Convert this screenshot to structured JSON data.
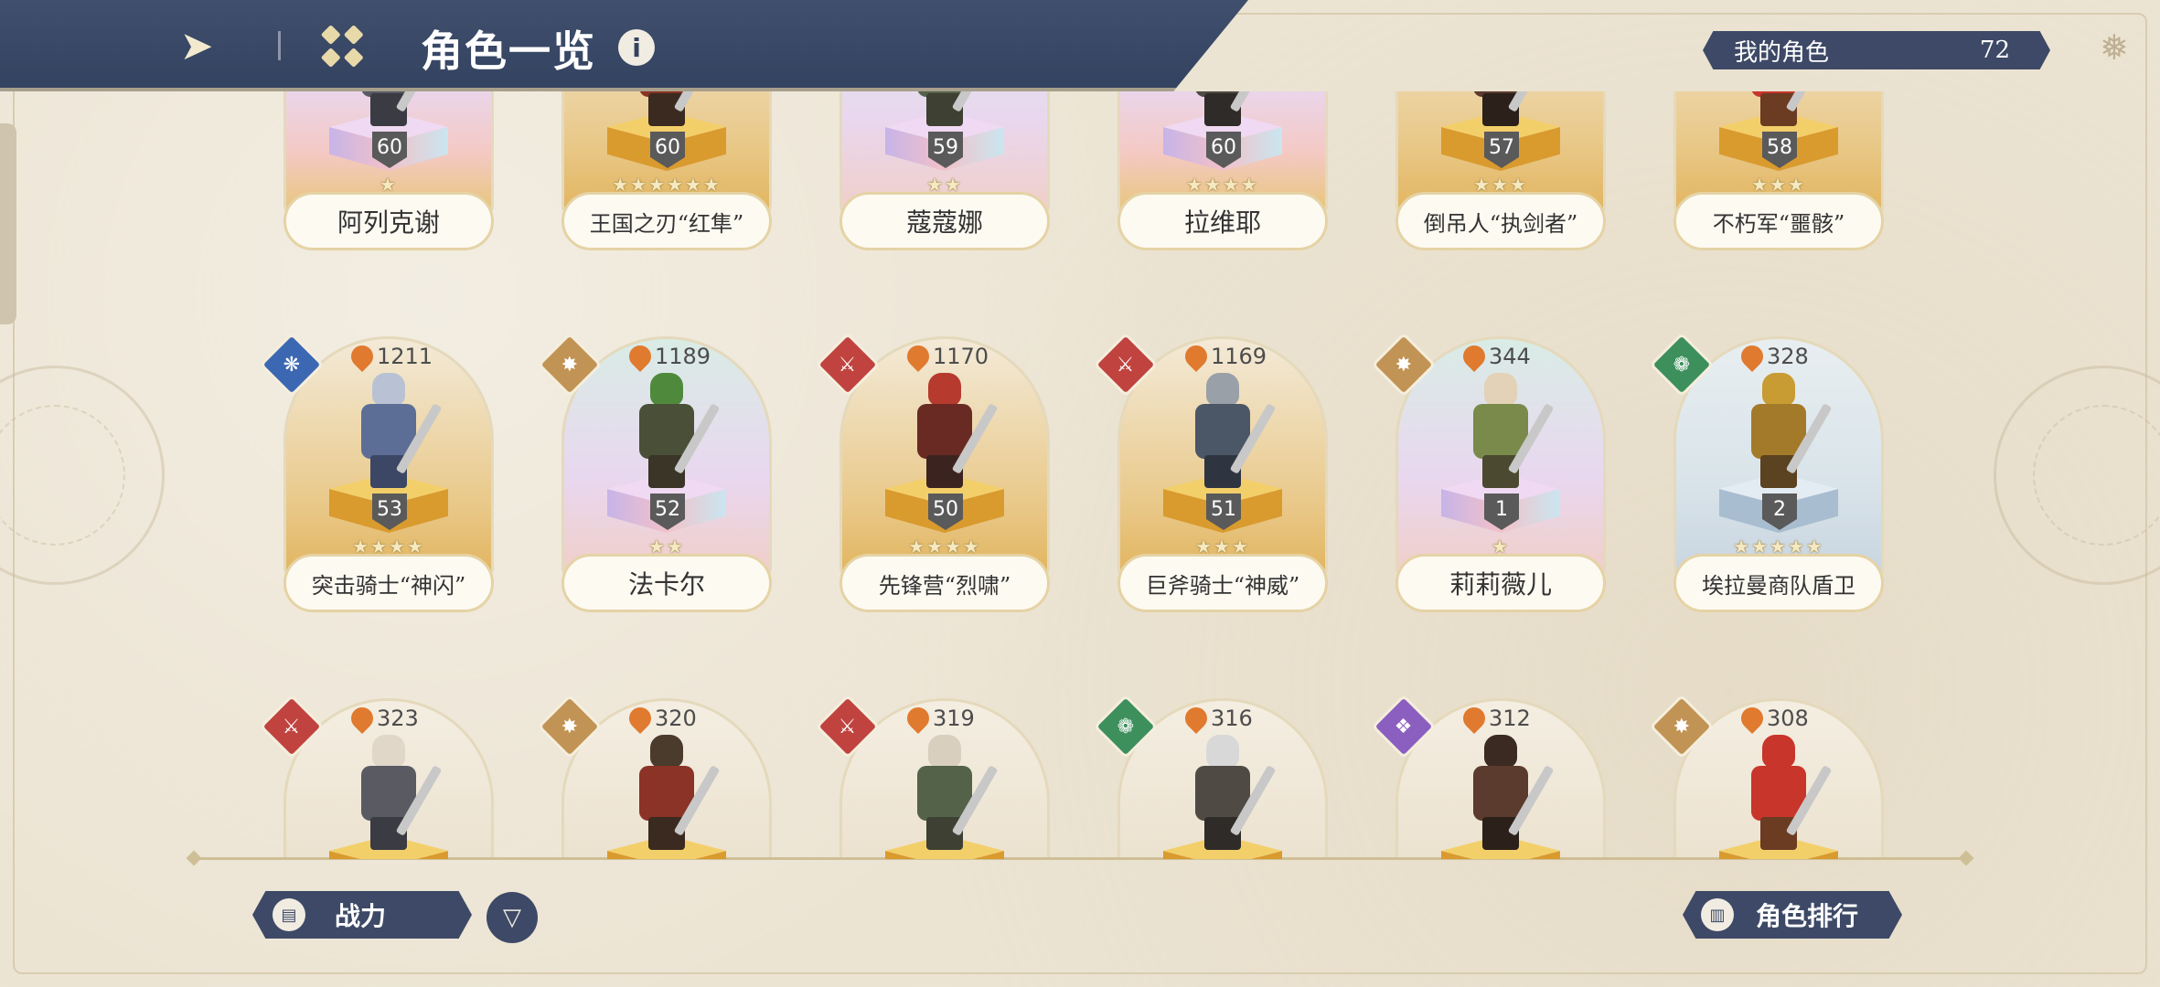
{
  "header": {
    "title": "角色一览",
    "back_icon": "back-arrow-icon",
    "menu_icon": "grid-menu-icon",
    "info_icon": "info-icon",
    "info_label": "i",
    "my_chars_label": "我的角色",
    "my_chars_count": "72"
  },
  "footer": {
    "sort_label": "战力",
    "sort_icon": "bar-chart-icon",
    "filter_icon": "filter-icon",
    "rank_label": "角色排行",
    "rank_icon": "podium-icon"
  },
  "colors": {
    "header": "#3f4f6d",
    "button": "#3d4966",
    "fire": "#c0433f",
    "wind": "#3d8f5c",
    "water": "#3c68b3",
    "light": "#c19354",
    "dark": "#8b5fbf"
  },
  "characters": [
    {
      "name": "阿列克谢",
      "level": "60",
      "stars": "★",
      "element": "wind",
      "pedestal": "rainbow",
      "card": "rainbow",
      "power": ""
    },
    {
      "name": "王国之刃“红隼”",
      "level": "60",
      "stars": "★★★★★★",
      "element": "water",
      "pedestal": "gold",
      "card": "gold",
      "power": ""
    },
    {
      "name": "蔻蔻娜",
      "level": "59",
      "stars": "★★",
      "element": "wind",
      "pedestal": "rainbow",
      "card": "teal",
      "power": ""
    },
    {
      "name": "拉维耶",
      "level": "60",
      "stars": "★★★★",
      "element": "fire",
      "pedestal": "rainbow",
      "card": "rainbow",
      "power": ""
    },
    {
      "name": "倒吊人“执剑者”",
      "level": "57",
      "stars": "★★★",
      "element": "dark",
      "pedestal": "gold",
      "card": "gold",
      "power": ""
    },
    {
      "name": "不朽军“噩骸”",
      "level": "58",
      "stars": "★★★",
      "element": "fire",
      "pedestal": "gold",
      "card": "gold",
      "power": ""
    },
    {
      "name": "突击骑士“神闪”",
      "level": "53",
      "stars": "★★★★",
      "element": "water",
      "pedestal": "gold",
      "card": "gold",
      "power": "1211"
    },
    {
      "name": "法卡尔",
      "level": "52",
      "stars": "★★",
      "element": "light",
      "pedestal": "rainbow",
      "card": "teal",
      "power": "1189"
    },
    {
      "name": "先锋营“烈啸”",
      "level": "50",
      "stars": "★★★★",
      "element": "fire",
      "pedestal": "gold",
      "card": "gold",
      "power": "1170"
    },
    {
      "name": "巨斧骑士“神威”",
      "level": "51",
      "stars": "★★★",
      "element": "fire",
      "pedestal": "gold",
      "card": "gold",
      "power": "1169"
    },
    {
      "name": "莉莉薇儿",
      "level": "1",
      "stars": "★",
      "element": "light",
      "pedestal": "rainbow",
      "card": "teal",
      "power": "344"
    },
    {
      "name": "埃拉曼商队盾卫",
      "level": "2",
      "stars": "★★★★★",
      "element": "wind",
      "pedestal": "silver",
      "card": "silver",
      "power": "328"
    },
    {
      "name": "",
      "level": "",
      "stars": "",
      "element": "fire",
      "pedestal": "gold",
      "card": "plain",
      "power": "323"
    },
    {
      "name": "",
      "level": "",
      "stars": "",
      "element": "light",
      "pedestal": "gold",
      "card": "plain",
      "power": "320"
    },
    {
      "name": "",
      "level": "",
      "stars": "",
      "element": "fire",
      "pedestal": "gold",
      "card": "plain",
      "power": "319"
    },
    {
      "name": "",
      "level": "",
      "stars": "",
      "element": "wind",
      "pedestal": "gold",
      "card": "plain",
      "power": "316"
    },
    {
      "name": "",
      "level": "",
      "stars": "",
      "element": "dark",
      "pedestal": "gold",
      "card": "plain",
      "power": "312"
    },
    {
      "name": "",
      "level": "",
      "stars": "",
      "element": "light",
      "pedestal": "gold",
      "card": "plain",
      "power": "308"
    }
  ]
}
